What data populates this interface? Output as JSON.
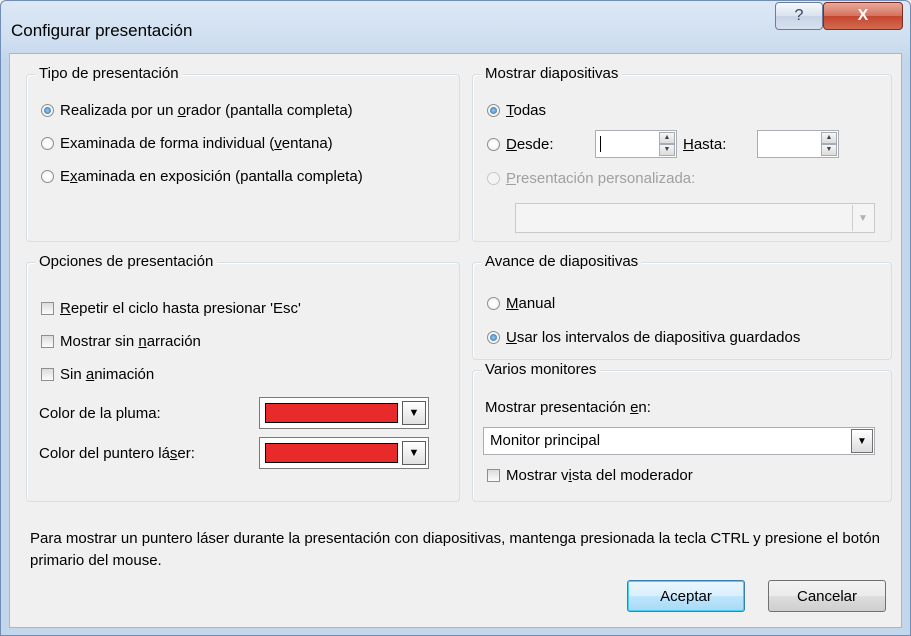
{
  "window": {
    "title": "Configurar presentación",
    "help_label": "?",
    "close_label": "X"
  },
  "tipo": {
    "legend": "Tipo de presentación",
    "options": [
      {
        "pre": "Realizada por un ",
        "key": "o",
        "post": "rador (pantalla completa)",
        "checked": true
      },
      {
        "pre": "Examinada de forma individual (",
        "key": "v",
        "post": "entana)",
        "checked": false
      },
      {
        "pre": "E",
        "key": "x",
        "post": "aminada en exposición (pantalla completa)",
        "checked": false
      }
    ]
  },
  "mostrar": {
    "legend": "Mostrar diapositivas",
    "todas": {
      "pre": "",
      "key": "T",
      "post": "odas"
    },
    "desde": {
      "pre": "",
      "key": "D",
      "post": "esde:"
    },
    "hasta": {
      "pre": "",
      "key": "H",
      "post": "asta:"
    },
    "desde_value": "",
    "hasta_value": "",
    "personalizada": {
      "pre": "",
      "key": "P",
      "post": "resentación personalizada:"
    },
    "personalizada_value": ""
  },
  "opciones": {
    "legend": "Opciones de presentación",
    "checks": [
      {
        "pre": "",
        "key": "R",
        "post": "epetir el ciclo hasta presionar 'Esc'"
      },
      {
        "pre": "Mostrar sin ",
        "key": "n",
        "post": "arración"
      },
      {
        "pre": "Sin ",
        "key": "a",
        "post": "nimación"
      }
    ],
    "pen_color_label": "Color de la pluma:",
    "laser_color_label_pre": "Color del puntero lá",
    "laser_color_label_key": "s",
    "laser_color_label_post": "er:",
    "pen_color": "#e82a2a",
    "laser_color": "#e82a2a"
  },
  "avance": {
    "legend": "Avance de diapositivas",
    "manual": {
      "pre": "",
      "key": "M",
      "post": "anual"
    },
    "usar": {
      "pre": "",
      "key": "U",
      "post": "sar los intervalos de diapositiva guardados"
    }
  },
  "monitores": {
    "legend": "Varios monitores",
    "label_pre": "Mostrar presentación ",
    "label_key": "e",
    "label_post": "n:",
    "monitor_value": "Monitor principal",
    "moderador": {
      "pre": "Mostrar v",
      "key": "i",
      "post": "sta del moderador"
    }
  },
  "info_text": "Para mostrar un puntero láser durante la presentación con diapositivas, mantenga presionada la tecla CTRL y presione el botón primario del mouse.",
  "buttons": {
    "ok": "Aceptar",
    "cancel": "Cancelar"
  }
}
